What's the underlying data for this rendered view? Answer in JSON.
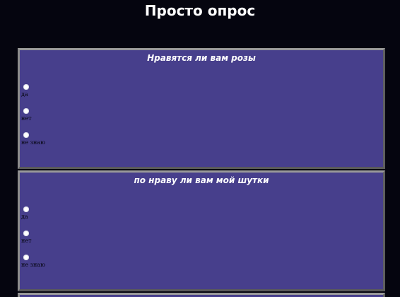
{
  "page": {
    "title": "Просто опрос"
  },
  "polls": [
    {
      "question": "Нравятся ли вам розы",
      "options": [
        "да",
        "нет",
        "не знаю"
      ]
    },
    {
      "question": "по нраву ли вам мой шутки",
      "options": [
        "да",
        "нет",
        "не знаю"
      ]
    }
  ],
  "colors": {
    "background": "#05050f",
    "panel": "#473f8c",
    "panel_border": "#7a7a7a",
    "title_text": "#ffffff",
    "option_text": "#050510"
  }
}
